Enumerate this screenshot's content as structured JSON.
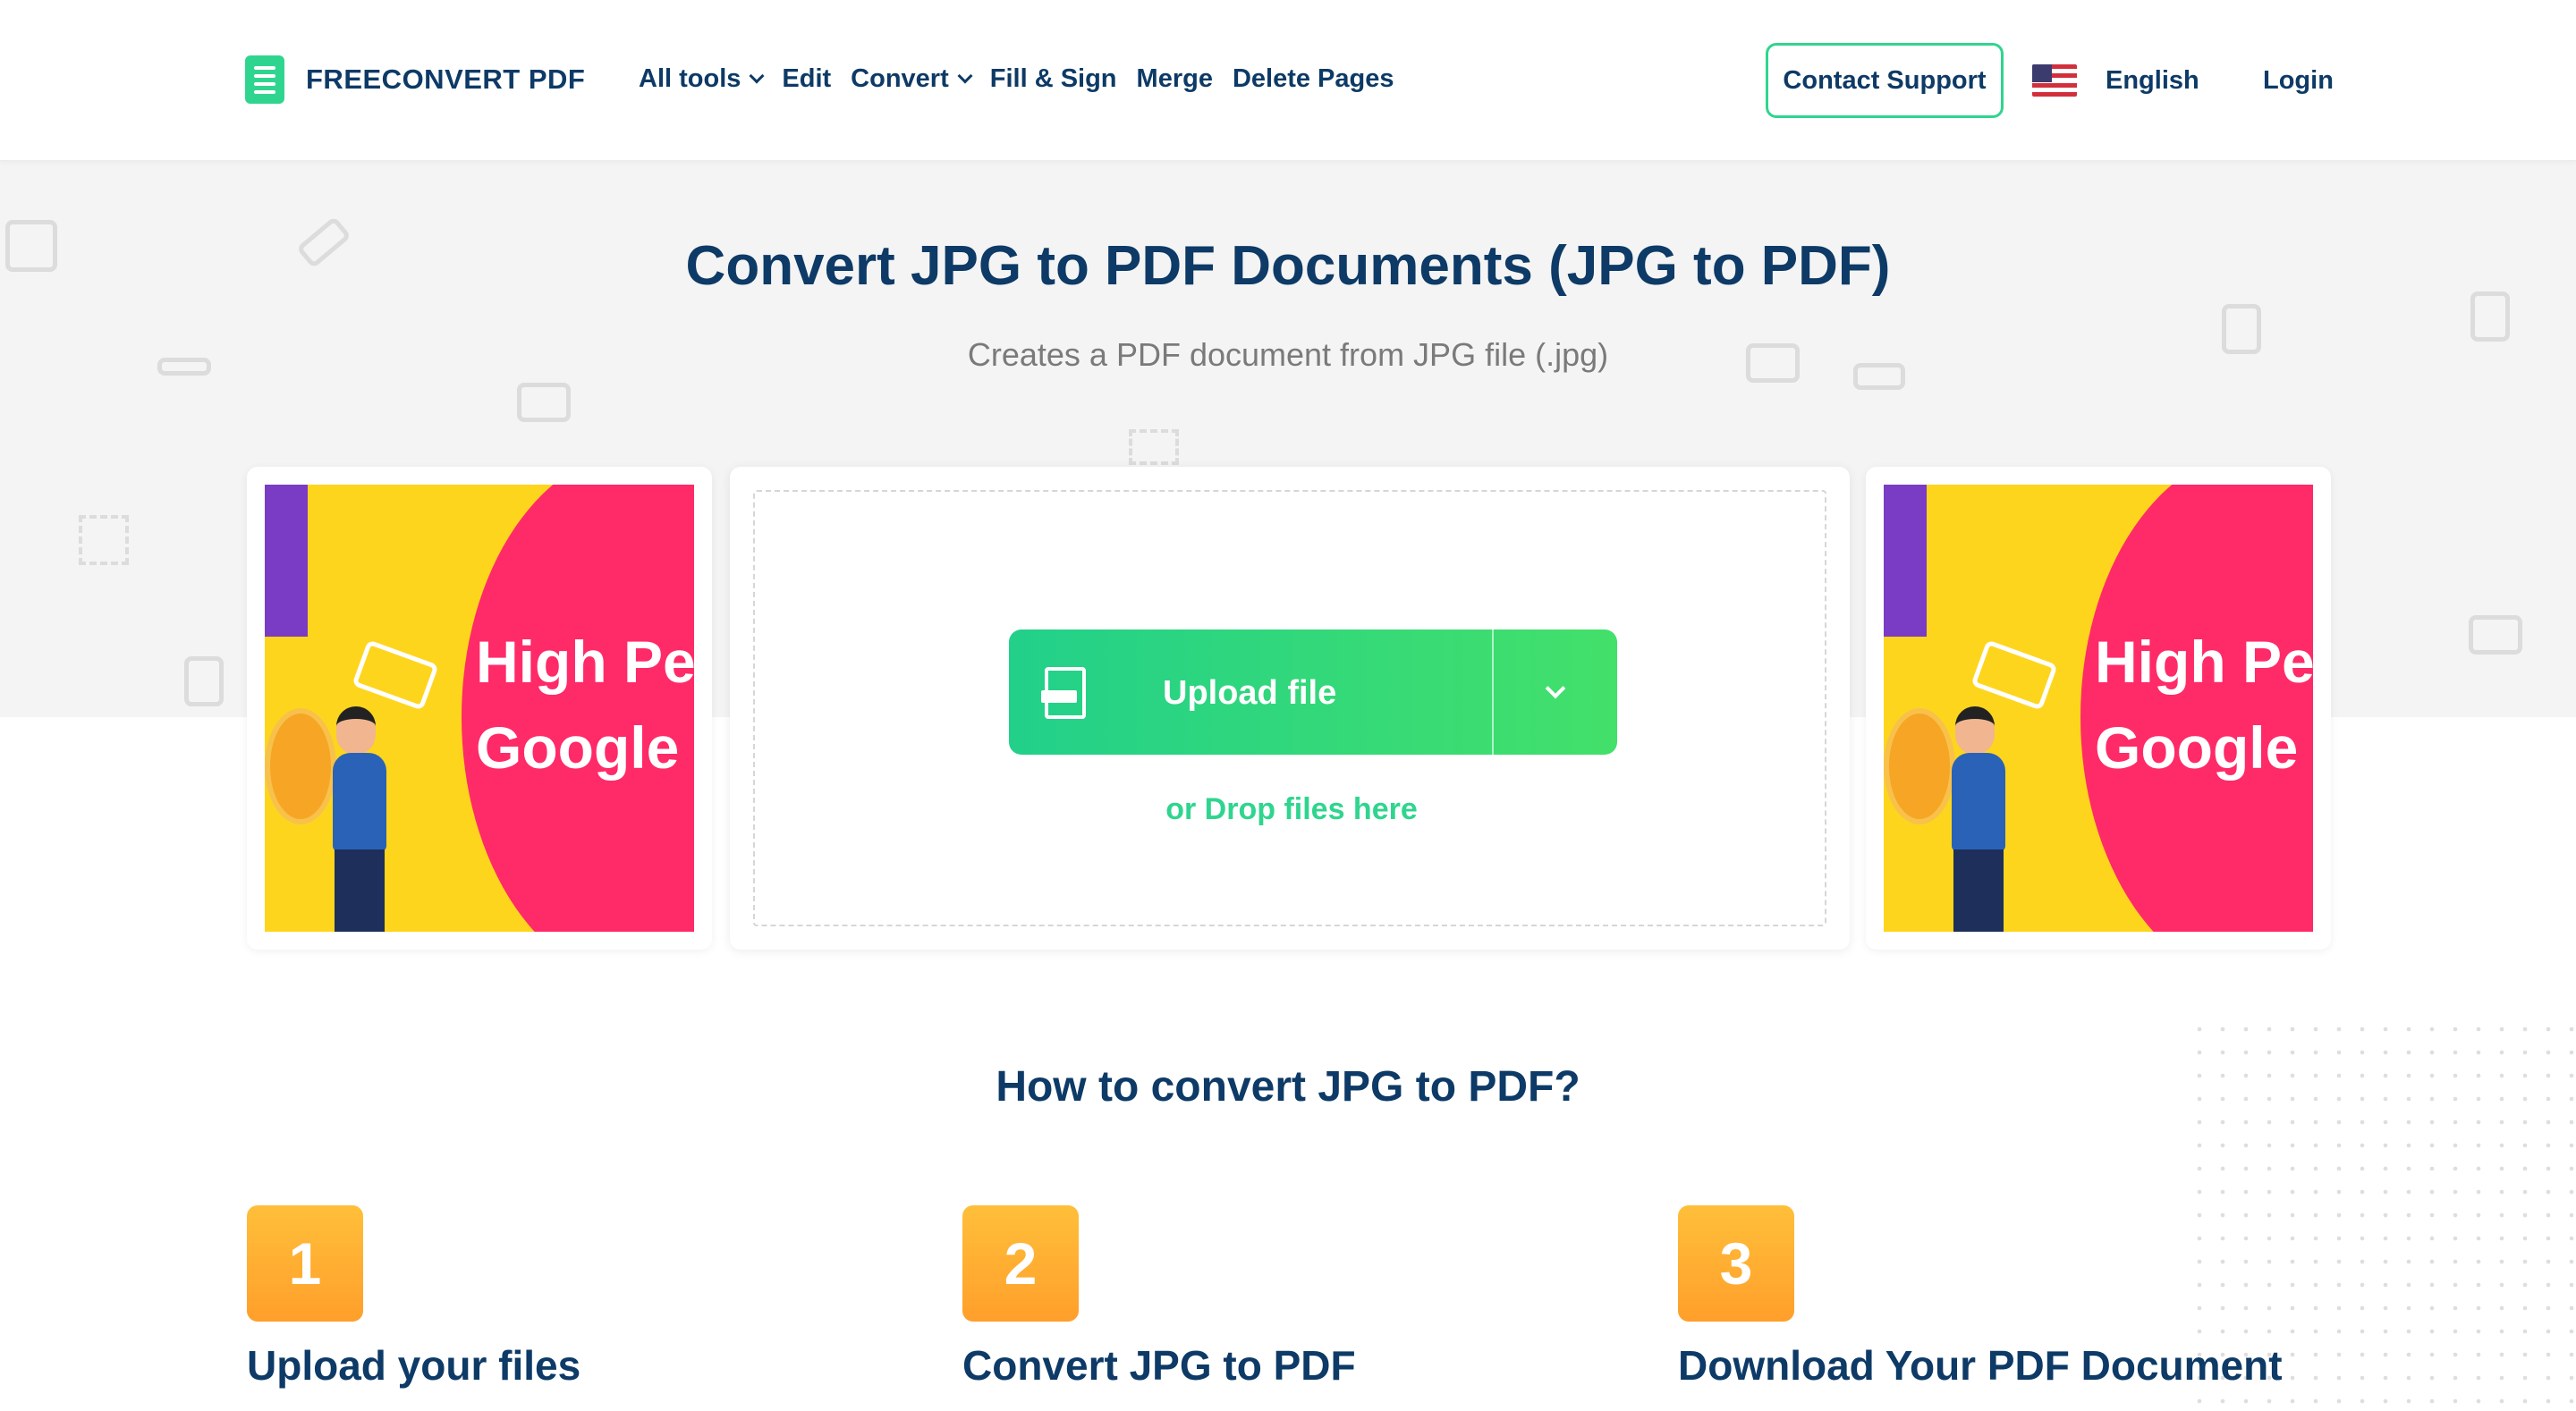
{
  "header": {
    "logo_text": "FREECONVERT PDF",
    "nav": [
      {
        "label": "All tools",
        "has_dropdown": true
      },
      {
        "label": "Edit",
        "has_dropdown": false
      },
      {
        "label": "Convert",
        "has_dropdown": true
      },
      {
        "label": "Fill & Sign",
        "has_dropdown": false
      },
      {
        "label": "Merge",
        "has_dropdown": false
      },
      {
        "label": "Delete Pages",
        "has_dropdown": false
      }
    ],
    "contact_support": "Contact Support",
    "language": "English",
    "login": "Login"
  },
  "hero": {
    "title": "Convert JPG to PDF Documents (JPG to PDF)",
    "subtitle": "Creates a PDF document from JPG file (.jpg)"
  },
  "ads": {
    "line1": "High Pe",
    "line2": "Google"
  },
  "upload": {
    "button_label": "Upload file",
    "drop_text": "or Drop files here"
  },
  "how_to": {
    "title": "How to convert JPG to PDF?",
    "steps": [
      {
        "number": "1",
        "title": "Upload your files"
      },
      {
        "number": "2",
        "title": "Convert JPG to PDF"
      },
      {
        "number": "3",
        "title": "Download Your PDF Document"
      }
    ]
  },
  "colors": {
    "brand_green": "#2fd58e",
    "navy_text": "#0d3a66",
    "step_orange": "#ff9f2b"
  }
}
